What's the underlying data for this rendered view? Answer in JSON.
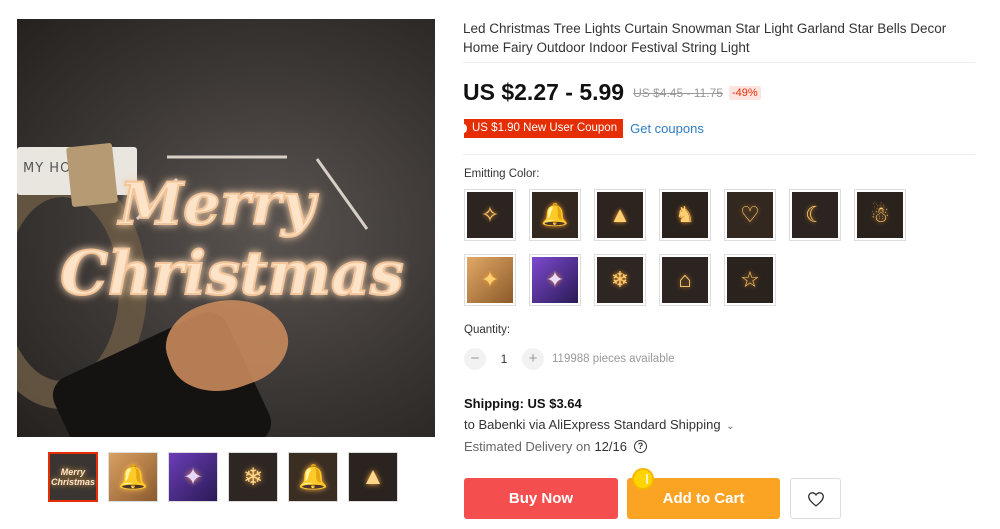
{
  "product": {
    "title": "Led Christmas Tree Lights Curtain Snowman Star Light Garland Star Bells Decor Home Fairy Outdoor Indoor Festival String Light",
    "main_image_text": "Merry Christmas",
    "sign_text": "MY HO",
    "thumbnails": [
      "thumb-merry",
      "thumb-warm",
      "thumb-purple",
      "thumb-snowflake",
      "thumb-bells",
      "thumb-tree"
    ],
    "thumb_first_text": "Merry Christmas"
  },
  "price": {
    "current": "US $2.27 - 5.99",
    "original": "US $4.45 - 11.75",
    "discount": "-49%"
  },
  "coupon": {
    "badge": "US $1.90 New User Coupon",
    "link": "Get coupons"
  },
  "variants": {
    "label": "Emitting Color:",
    "options": [
      "angel",
      "bell",
      "tree",
      "deer",
      "heart",
      "moon",
      "snowman",
      "warm-curtain",
      "purple-curtain",
      "snowflake",
      "house",
      "star"
    ]
  },
  "quantity": {
    "label": "Quantity:",
    "minus": "−",
    "value": "1",
    "plus": "+",
    "available": "119988 pieces available"
  },
  "shipping": {
    "cost": "Shipping: US $3.64",
    "route": "to Babenki via AliExpress Standard Shipping",
    "chevron": "⌄",
    "estimate_label": "Estimated Delivery on",
    "estimate_date": "12/16",
    "help": "?"
  },
  "actions": {
    "buy": "Buy Now",
    "cart": "Add to Cart"
  },
  "colors": {
    "accent_red": "#e62e04",
    "buy_button": "#f54e4e",
    "cart_button": "#fba323",
    "link_blue": "#2e7cc6"
  }
}
